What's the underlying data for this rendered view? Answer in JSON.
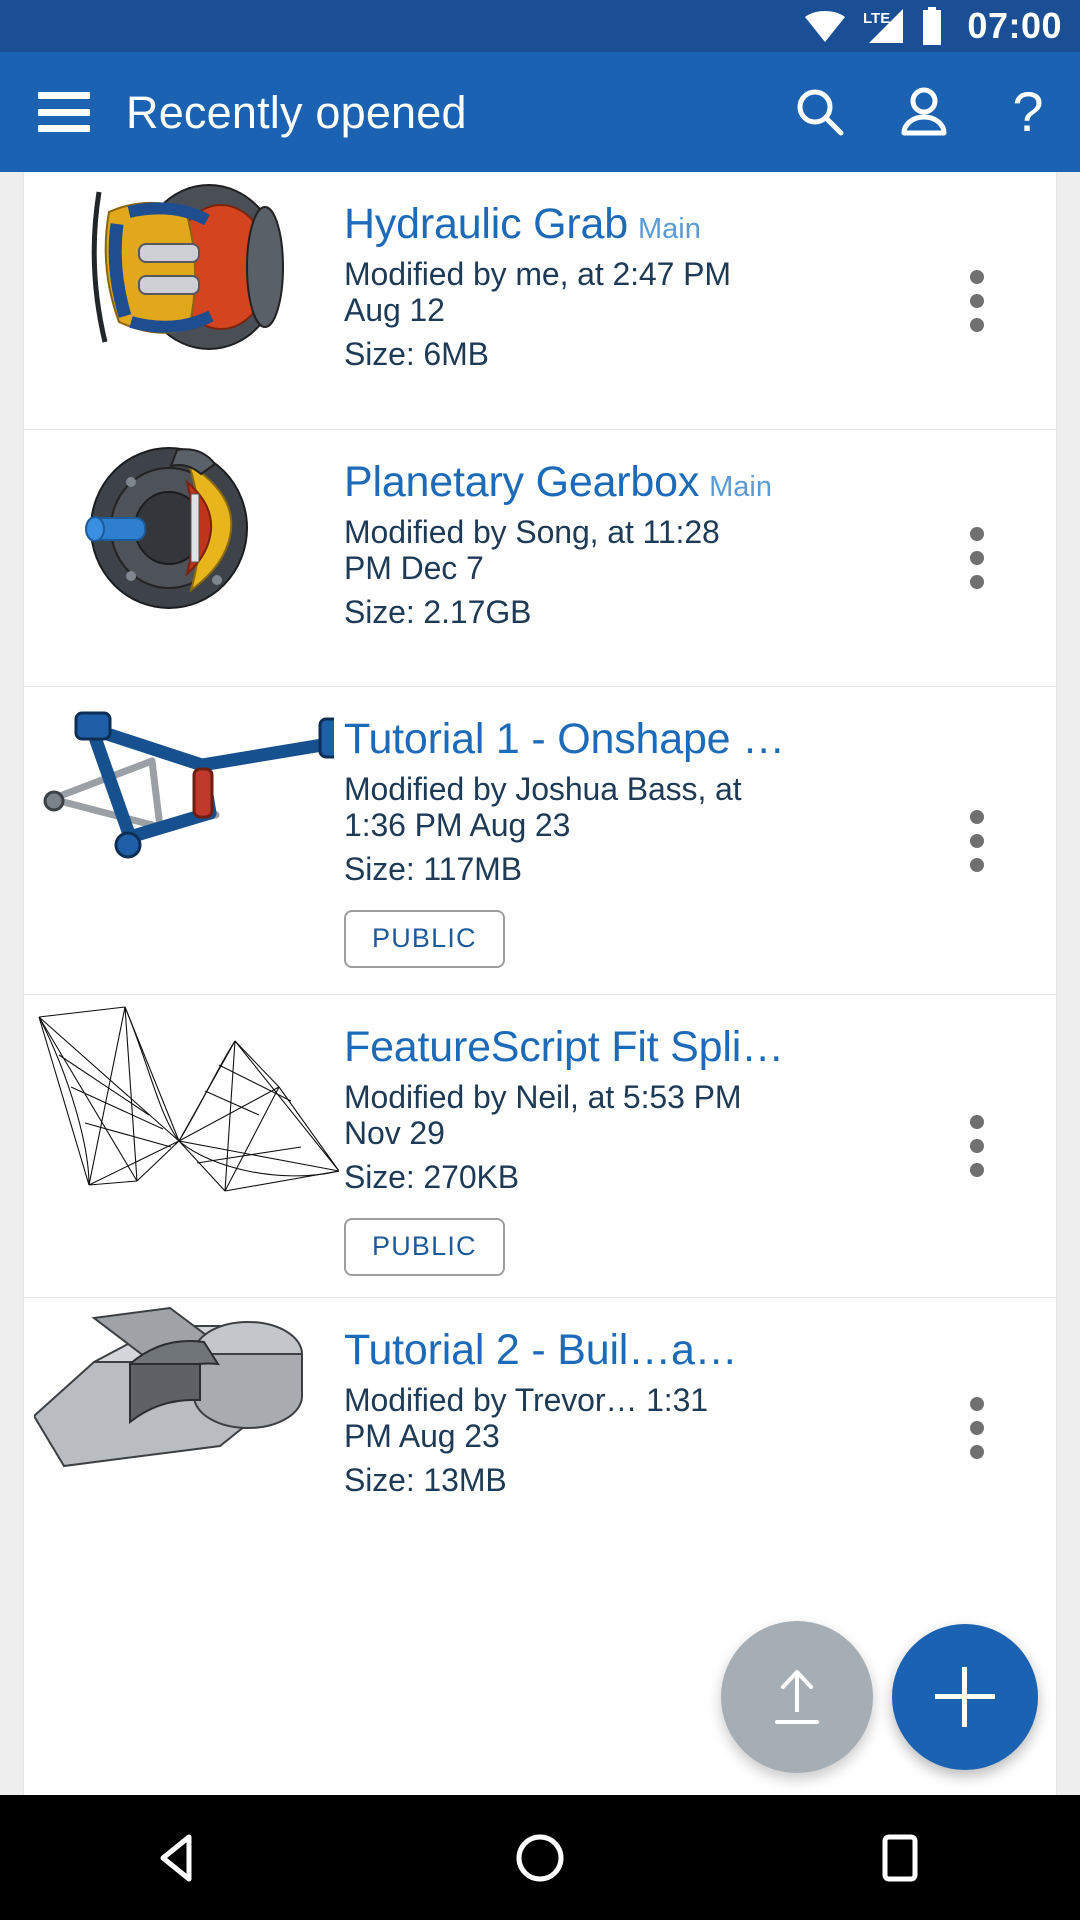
{
  "status_bar": {
    "wifi_icon": "wifi-icon",
    "network_label": "LTE",
    "signal_icon": "signal-icon",
    "battery_icon": "battery-icon",
    "clock": "07:00",
    "background_color": "#1a4f96"
  },
  "app_bar": {
    "menu_icon": "hamburger-menu-icon",
    "title": "Recently opened",
    "search_icon": "search-icon",
    "account_icon": "person-icon",
    "help_label": "?",
    "background_color": "#1b62b3"
  },
  "documents": [
    {
      "name": "Hydraulic Grab",
      "branch": "Main",
      "modified": "Modified by me, at 2:47 PM Aug 12",
      "size": "Size: 6MB",
      "badge": null,
      "thumbnail_icon": "hydraulic-grab-thumbnail",
      "overflow_icon": "overflow-menu-icon"
    },
    {
      "name": "Planetary Gearbox",
      "branch": "Main",
      "modified": "Modified by Song, at 11:28 PM Dec 7",
      "size": "Size: 2.17GB",
      "badge": null,
      "thumbnail_icon": "planetary-gearbox-thumbnail",
      "overflow_icon": "overflow-menu-icon"
    },
    {
      "name": "Tutorial 1 - Onshape …",
      "branch": null,
      "modified": "Modified by Joshua Bass, at 1:36 PM Aug 23",
      "size": "Size: 117MB",
      "badge": "PUBLIC",
      "thumbnail_icon": "bike-frame-thumbnail",
      "overflow_icon": "overflow-menu-icon"
    },
    {
      "name": "FeatureScript Fit Spli…",
      "branch": null,
      "modified": "Modified by Neil, at 5:53 PM Nov 29",
      "size": "Size: 270KB",
      "badge": "PUBLIC",
      "thumbnail_icon": "spline-surface-thumbnail",
      "overflow_icon": "overflow-menu-icon"
    },
    {
      "name": "Tutorial 2 - Buil…a…",
      "branch": null,
      "modified": "Modified by Trevor… 1:31 PM Aug 23",
      "size": "Size: 13MB",
      "badge": null,
      "thumbnail_icon": "bracket-part-thumbnail",
      "overflow_icon": "overflow-menu-icon"
    }
  ],
  "fabs": {
    "upload_icon": "upload-icon",
    "upload_color": "#a5adb5",
    "add_icon": "plus-icon",
    "add_color": "#1b62b3"
  },
  "nav_bar": {
    "back_icon": "back-triangle-icon",
    "home_icon": "home-circle-icon",
    "recents_icon": "recents-square-icon",
    "background_color": "#000000"
  },
  "colors": {
    "title_link": "#1d6bb8",
    "branch": "#5b9bd5",
    "meta_text": "#1d3a56",
    "page_background": "#eeeeee",
    "card_background": "#ffffff"
  }
}
